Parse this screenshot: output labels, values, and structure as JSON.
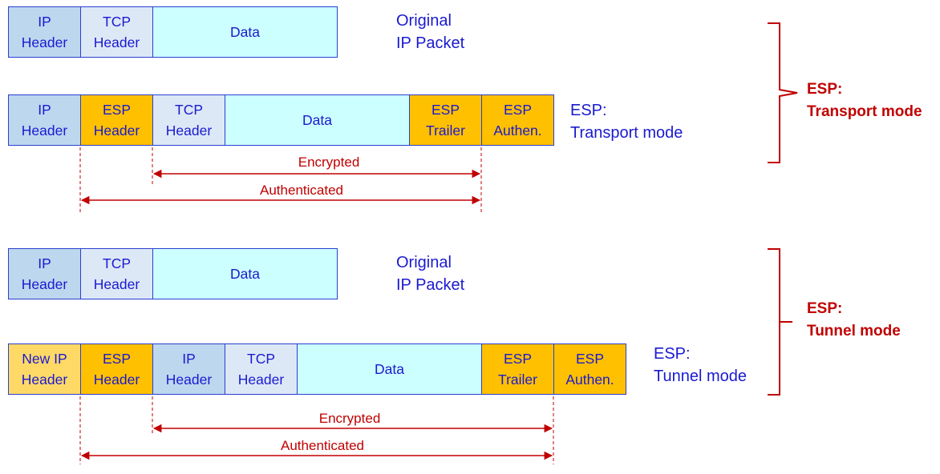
{
  "colors": {
    "ip_header": "#bdd7ee",
    "tcp_header": "#dde8f6",
    "data": "#ccffff",
    "esp": "#ffc000",
    "new_ip_header": "#ffd966",
    "text_blue": "#1a1ad0",
    "accent_red": "#c00000"
  },
  "sections": [
    {
      "original": {
        "label": "Original\nIP Packet",
        "cells": [
          {
            "text": "IP\nHeader",
            "kind": "ip_header"
          },
          {
            "text": "TCP\nHeader",
            "kind": "tcp_header"
          },
          {
            "text": "Data",
            "kind": "data"
          }
        ]
      },
      "esp": {
        "label": "ESP:\nTransport mode",
        "cells": [
          {
            "text": "IP\nHeader",
            "kind": "ip_header"
          },
          {
            "text": "ESP\nHeader",
            "kind": "esp"
          },
          {
            "text": "TCP\nHeader",
            "kind": "tcp_header"
          },
          {
            "text": "Data",
            "kind": "data"
          },
          {
            "text": "ESP\nTrailer",
            "kind": "esp"
          },
          {
            "text": "ESP\nAuthen.",
            "kind": "esp"
          }
        ]
      },
      "encrypted_label": "Encrypted",
      "authenticated_label": "Authenticated",
      "bracket_label": "ESP:\nTransport mode"
    },
    {
      "original": {
        "label": "Original\nIP Packet",
        "cells": [
          {
            "text": "IP\nHeader",
            "kind": "ip_header"
          },
          {
            "text": "TCP\nHeader",
            "kind": "tcp_header"
          },
          {
            "text": "Data",
            "kind": "data"
          }
        ]
      },
      "esp": {
        "label": "ESP:\nTunnel mode",
        "cells": [
          {
            "text": "New IP\nHeader",
            "kind": "new_ip_header"
          },
          {
            "text": "ESP\nHeader",
            "kind": "esp"
          },
          {
            "text": "IP\nHeader",
            "kind": "ip_header"
          },
          {
            "text": "TCP\nHeader",
            "kind": "tcp_header"
          },
          {
            "text": "Data",
            "kind": "data"
          },
          {
            "text": "ESP\nTrailer",
            "kind": "esp"
          },
          {
            "text": "ESP\nAuthen.",
            "kind": "esp"
          }
        ]
      },
      "encrypted_label": "Encrypted",
      "authenticated_label": "Authenticated",
      "bracket_label": "ESP:\nTunnel mode"
    }
  ]
}
